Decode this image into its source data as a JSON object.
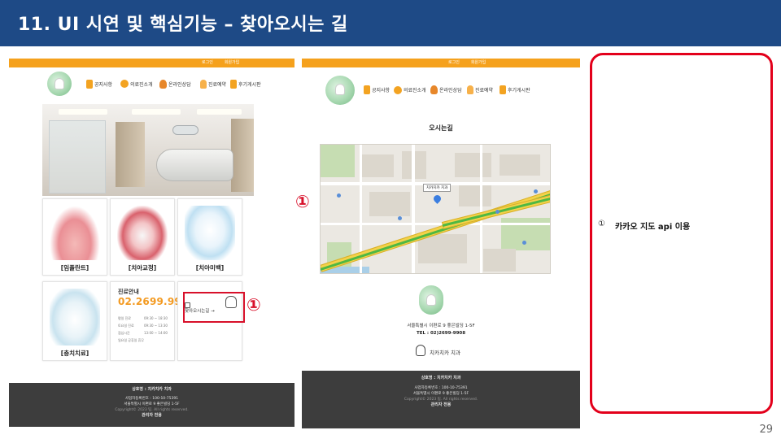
{
  "slide": {
    "title": "11. UI 시연 및 핵심기능 – 찾아오시는 길",
    "page_number": "29",
    "accent_color": "#1e4a86",
    "marker_color": "#d8102a"
  },
  "site_header": {
    "top_links": [
      "로그인",
      "회원가입"
    ],
    "nav_items": [
      {
        "label": "공지사항",
        "icon": "document-icon"
      },
      {
        "label": "의료진소개",
        "icon": "shield-icon"
      },
      {
        "label": "온라인상담",
        "icon": "person-icon"
      },
      {
        "label": "진료예약",
        "icon": "tooth-icon"
      },
      {
        "label": "후기게시판",
        "icon": "document-icon"
      }
    ]
  },
  "home": {
    "cards": [
      {
        "label": "[임플란트]"
      },
      {
        "label": "[치아교정]"
      },
      {
        "label": "[치아미백]"
      },
      {
        "label": "[충치치료]"
      }
    ],
    "info": {
      "title": "진료안내",
      "phone": "02.2699.9908",
      "rows": [
        {
          "label": "평일 진료",
          "time": "09:30 ~ 18:30"
        },
        {
          "label": "토요일 진료",
          "time": "09:30 ~ 13:30"
        },
        {
          "label": "점심시간",
          "time": "13:00 ~ 14:00"
        },
        {
          "label": "일요일 공휴일 휴무",
          "time": ""
        }
      ]
    },
    "directions_label": "찾아오시는길 →",
    "marker": "①"
  },
  "map_page": {
    "title": "오시는길",
    "pin_label": "치카치카 치과",
    "address": "서울특별시 이편로 9 좋은빌딩 1-5F",
    "tel": "TEL : 02)2699-9908",
    "clinic_name": "치카치카 치과",
    "marker": "①"
  },
  "footer": {
    "company": "상호명 : 치카치카 치과",
    "biz_no": "사업자등록번호 : 100-10-75391",
    "address": "서울특별시 이편로 9 좋은빌딩 1-5F",
    "copyright": "Copyright© 2023 팀. All rights reserved.",
    "admin": "관리자 전용"
  },
  "annotation": {
    "number": "①",
    "text": "카카오 지도 api 이용"
  }
}
